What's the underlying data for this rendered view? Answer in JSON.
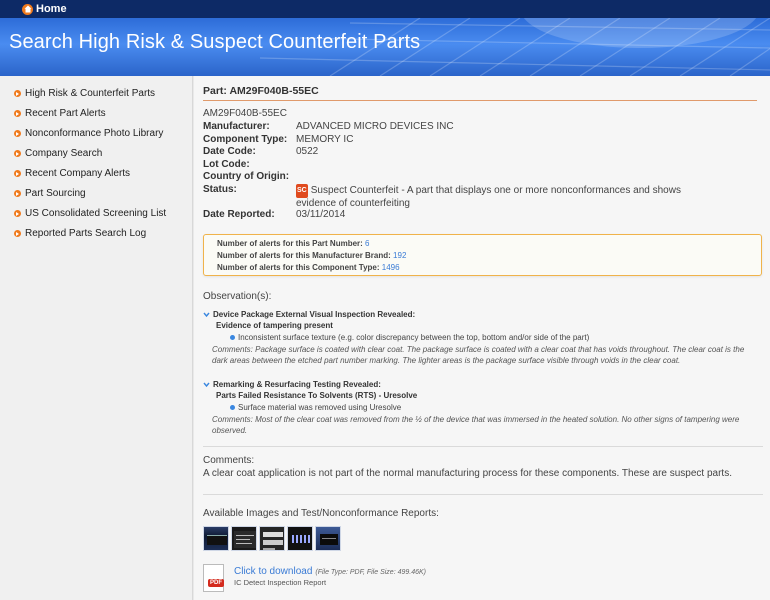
{
  "nav": {
    "home_label": "Home"
  },
  "banner": {
    "title": "Search High Risk & Suspect Counterfeit Parts"
  },
  "sidebar": {
    "items": [
      {
        "label": "High Risk & Counterfeit Parts"
      },
      {
        "label": "Recent Part Alerts"
      },
      {
        "label": "Nonconformance Photo Library"
      },
      {
        "label": "Company Search"
      },
      {
        "label": "Recent Company Alerts"
      },
      {
        "label": "Part Sourcing"
      },
      {
        "label": "US Consolidated Screening List"
      },
      {
        "label": "Reported Parts Search Log"
      }
    ]
  },
  "part": {
    "title": "Part: AM29F040B-55EC",
    "number": "AM29F040B-55EC",
    "manufacturer_label": "Manufacturer:",
    "manufacturer": "ADVANCED MICRO DEVICES INC",
    "component_type_label": "Component Type:",
    "component_type": "MEMORY IC",
    "date_code_label": "Date Code:",
    "date_code": "0522",
    "lot_code_label": "Lot Code:",
    "lot_code": "",
    "country_label": "Country of Origin:",
    "country": "",
    "status_label": "Status:",
    "status_badge": "SC",
    "status_text": "Suspect Counterfeit - A part that displays one or more nonconformances and shows evidence of counterfeiting",
    "date_reported_label": "Date Reported:",
    "date_reported": "03/11/2014"
  },
  "alerts": {
    "part_number_label": "Number of alerts for this Part Number:",
    "part_number_count": "6",
    "brand_label": "Number of alerts for this Manufacturer Brand:",
    "brand_count": "192",
    "component_label": "Number of alerts for this Component Type:",
    "component_count": "1496"
  },
  "observations": {
    "title": "Observation(s):",
    "items": [
      {
        "heading": "Device Package External Visual Inspection Revealed:",
        "sub": "Evidence of tampering present",
        "bullet": "Inconsistent surface texture (e.g. color discrepancy between the top, bottom and/or side of the part)",
        "comment": "Comments: Package surface is coated with clear coat. The package surface is coated with a clear coat that has voids throughout. The clear coat is the dark areas between the etched part number marking. The lighter areas is the package surface visible through voids in the clear coat."
      },
      {
        "heading": "Remarking & Resurfacing Testing Revealed:",
        "sub": "Parts Failed Resistance To Solvents (RTS) - Uresolve",
        "bullet": "Surface material was removed using Uresolve",
        "comment": "Comments: Most of the clear coat was removed from the ½ of the device that was immersed in the heated solution. No other signs of tampering were observed."
      }
    ]
  },
  "comments": {
    "label": "Comments:",
    "text": "A clear coat application is not part of the normal manufacturing process for these components. These are suspect parts."
  },
  "images": {
    "label": "Available Images and Test/Nonconformance Reports:",
    "download_label": "Click to download",
    "file_meta": "(File Type: PDF, File Size: 499.46K)",
    "report_name": "IC Detect Inspection Report",
    "pdf_tag": "PDF"
  },
  "colors": {
    "accent": "#f07a1c",
    "link": "#3a7bd5",
    "header": "#0d2a66",
    "badge": "#e04a1e"
  }
}
